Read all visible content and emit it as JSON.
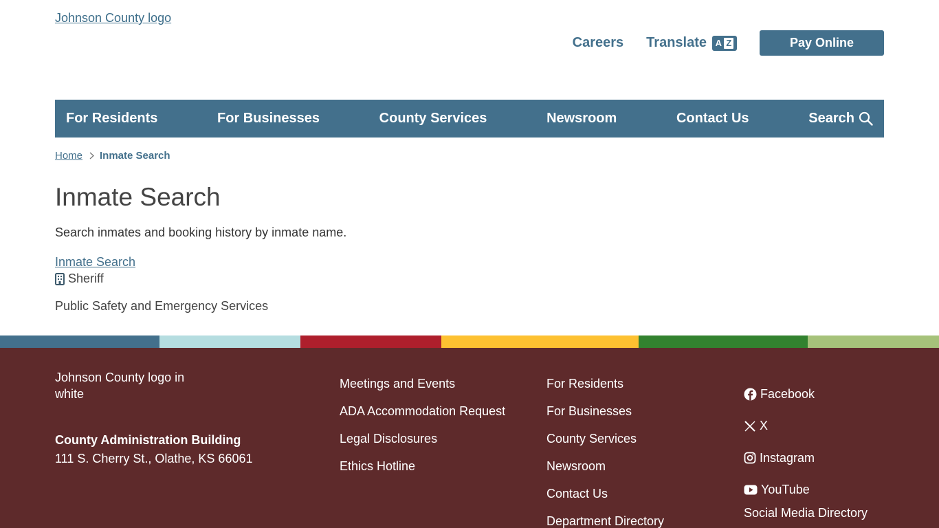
{
  "header": {
    "logo_alt": "Johnson County logo",
    "careers": "Careers",
    "translate": "Translate",
    "translate_glyph_a": "A",
    "translate_glyph_b": "Z",
    "pay_online": "Pay Online"
  },
  "nav": {
    "items": [
      "For Residents",
      "For Businesses",
      "County Services",
      "Newsroom",
      "Contact Us"
    ],
    "search": "Search"
  },
  "breadcrumb": {
    "home": "Home",
    "current": "Inmate Search"
  },
  "main": {
    "title": "Inmate Search",
    "description": "Search inmates and booking history by inmate name.",
    "result_link": "Inmate Search",
    "department": "Sheriff",
    "category": "Public Safety and Emergency Services"
  },
  "stripe_colors": [
    "#43708c",
    "#b5dde0",
    "#ae1f2c",
    "#fdc131",
    "#32822f",
    "#a6c27a"
  ],
  "footer": {
    "logo_alt": "Johnson County logo in white",
    "building": "County Administration Building",
    "address": "111 S. Cherry St., Olathe, KS 66061",
    "links_col1": [
      "Meetings and Events",
      "ADA Accommodation Request",
      "Legal Disclosures",
      "Ethics Hotline"
    ],
    "links_col2": [
      "For Residents",
      "For Businesses",
      "County Services",
      "Newsroom",
      "Contact Us",
      "Department Directory"
    ],
    "social": {
      "facebook": "Facebook",
      "x": "X",
      "instagram": "Instagram",
      "youtube": "YouTube",
      "directory": "Social Media Directory"
    }
  },
  "colors": {
    "brand_blue": "#43708c",
    "footer_bg": "#5e2a2b"
  }
}
